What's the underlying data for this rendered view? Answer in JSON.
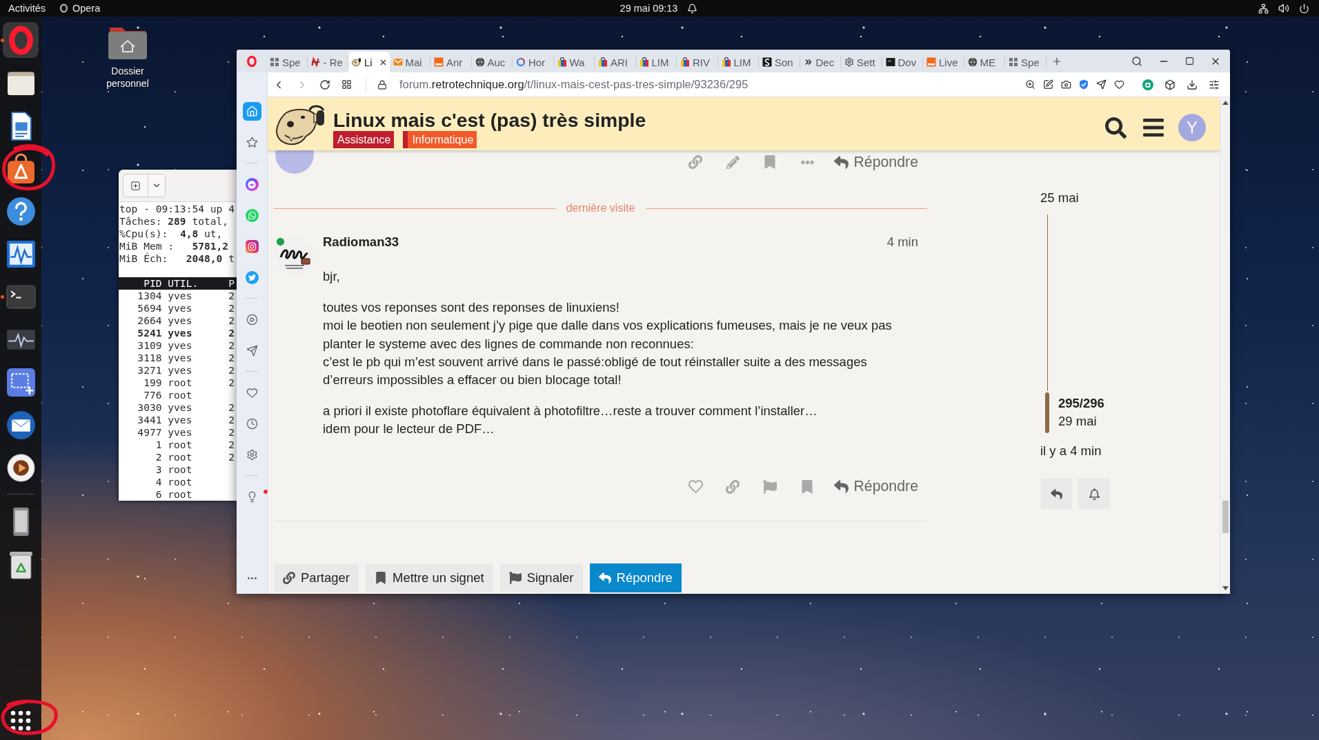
{
  "top_bar": {
    "activities": "Activités",
    "app_menu": "Opera",
    "date": "29 mai",
    "time": "09:13"
  },
  "dock": {
    "apps": [
      {
        "kind": "opera",
        "selected": true,
        "running": true,
        "circled": false
      },
      {
        "kind": "files",
        "selected": false,
        "running": false,
        "circled": false
      },
      {
        "kind": "writer",
        "selected": false,
        "running": false,
        "circled": false
      },
      {
        "kind": "software",
        "selected": false,
        "running": false,
        "circled": true
      },
      {
        "kind": "help",
        "selected": false,
        "running": false,
        "circled": false
      },
      {
        "kind": "monitor",
        "selected": false,
        "running": false,
        "circled": false
      },
      {
        "kind": "terminal",
        "selected": false,
        "running": true,
        "circled": false
      },
      {
        "kind": "activity",
        "selected": false,
        "running": false,
        "circled": false
      },
      {
        "kind": "screenshot",
        "selected": false,
        "running": false,
        "circled": false
      },
      {
        "kind": "mail",
        "selected": false,
        "running": false,
        "circled": false
      },
      {
        "kind": "music",
        "selected": false,
        "running": false,
        "circled": false
      },
      {
        "kind": "separator"
      },
      {
        "kind": "phone",
        "selected": false,
        "running": false,
        "circled": false
      },
      {
        "kind": "trash",
        "selected": false,
        "running": false,
        "circled": false
      }
    ],
    "app_grid": {
      "circled": true
    }
  },
  "desktop_icons": [
    {
      "label": "Dossier personnel"
    }
  ],
  "terminal": {
    "summary": [
      "top - 09:13:54 up 4",
      "Tâches: **289** total,",
      "%Cpu(s):  **4,8** ut,",
      "MiB Mem :   **5781,2**",
      "MiB Éch:   **2048,0** t"
    ],
    "columns": [
      "PID",
      "UTIL.",
      "P"
    ],
    "rows": [
      {
        "pid": "1304",
        "user": "yves",
        "column_3": "2",
        "highlighted": false
      },
      {
        "pid": "5694",
        "user": "yves",
        "column_3": "2",
        "highlighted": false
      },
      {
        "pid": "2664",
        "user": "yves",
        "column_3": "2",
        "highlighted": false
      },
      {
        "pid": "5241",
        "user": "yves",
        "column_3": "2",
        "highlighted": true
      },
      {
        "pid": "3109",
        "user": "yves",
        "column_3": "2",
        "highlighted": false
      },
      {
        "pid": "3118",
        "user": "yves",
        "column_3": "2",
        "highlighted": false
      },
      {
        "pid": "3271",
        "user": "yves",
        "column_3": "2",
        "highlighted": false
      },
      {
        "pid": "199",
        "user": "root",
        "column_3": "2",
        "highlighted": false
      },
      {
        "pid": "776",
        "user": "root",
        "highlighted": false
      },
      {
        "pid": "3030",
        "user": "yves",
        "column_3": "2",
        "highlighted": false
      },
      {
        "pid": "3441",
        "user": "yves",
        "column_3": "2",
        "highlighted": false
      },
      {
        "pid": "4977",
        "user": "yves",
        "column_3": "2",
        "highlighted": false
      },
      {
        "pid": "1",
        "user": "root",
        "column_3": "2",
        "highlighted": false
      },
      {
        "pid": "2",
        "user": "root",
        "column_3": "2",
        "highlighted": false
      },
      {
        "pid": "3",
        "user": "root",
        "highlighted": false
      },
      {
        "pid": "4",
        "user": "root",
        "highlighted": false
      },
      {
        "pid": "6",
        "user": "root",
        "highlighted": false
      }
    ]
  },
  "browser": {
    "tabs": [
      {
        "title": "Spe",
        "kind": "grid",
        "selected": false
      },
      {
        "title": "- Re",
        "kind": "news",
        "selected": false
      },
      {
        "title": "Li",
        "kind": "forum",
        "selected": true
      },
      {
        "title": "Mai",
        "kind": "mail",
        "selected": false
      },
      {
        "title": "Anr",
        "kind": "square",
        "selected": false
      },
      {
        "title": "Auc",
        "kind": "globe",
        "selected": false
      },
      {
        "title": "Hor",
        "kind": "ring",
        "selected": false
      },
      {
        "title": "Wa",
        "kind": "bag",
        "selected": false
      },
      {
        "title": "ARI",
        "kind": "bag",
        "selected": false
      },
      {
        "title": "LIM",
        "kind": "bag",
        "selected": false
      },
      {
        "title": "RIV",
        "kind": "bag",
        "selected": false
      },
      {
        "title": "LIM",
        "kind": "bag",
        "selected": false
      },
      {
        "title": "Son",
        "kind": "letter",
        "selected": false
      },
      {
        "title": "Dec",
        "kind": "chevrons",
        "selected": false
      },
      {
        "title": "Sett",
        "kind": "gear",
        "selected": false
      },
      {
        "title": "Dov",
        "kind": "screen",
        "selected": false
      },
      {
        "title": "Live",
        "kind": "square",
        "selected": false
      },
      {
        "title": "ME",
        "kind": "globe",
        "selected": false
      },
      {
        "title": "Spe",
        "kind": "grid",
        "selected": false
      }
    ],
    "url": {
      "subdomain": "forum.",
      "domain": "retrotechnique.org",
      "path": "/t/linux-mais-cest-pas-tres-simple/93236/295"
    },
    "sidebar": [
      {
        "kind": "home",
        "selected": true
      },
      {
        "kind": "star",
        "selected": false
      },
      {
        "kind": "divider"
      },
      {
        "kind": "messenger",
        "selected": false
      },
      {
        "kind": "whatsapp",
        "selected": false
      },
      {
        "kind": "instagram",
        "selected": false
      },
      {
        "kind": "twitter",
        "selected": false
      },
      {
        "kind": "divider"
      },
      {
        "kind": "player",
        "selected": false
      },
      {
        "kind": "flow",
        "selected": false
      },
      {
        "kind": "divider"
      },
      {
        "kind": "heart",
        "selected": false
      },
      {
        "kind": "history",
        "selected": false
      },
      {
        "kind": "settings",
        "selected": false
      },
      {
        "kind": "divider"
      },
      {
        "kind": "tips",
        "selected": false,
        "notification": true
      },
      {
        "kind": "more",
        "selected": false
      }
    ]
  },
  "page": {
    "title": "Linux mais c'est (pas) très simple",
    "tags": [
      {
        "label": "Assistance",
        "color": "#bf1e2e"
      },
      {
        "label": "Informatique",
        "color": "#f1592a",
        "parent": {
          "color": "#bf1e2e"
        }
      }
    ],
    "user_initial": "Y",
    "previous_post": {
      "actions": [
        {
          "kind": "link"
        },
        {
          "kind": "edit"
        },
        {
          "kind": "bookmark"
        },
        {
          "kind": "more"
        }
      ],
      "reply": "Répondre"
    },
    "last_visit": "dernière visite",
    "post": {
      "author": "Radioman33",
      "online": true,
      "age": "4 min",
      "paragraphs": [
        [
          "bjr,"
        ],
        [
          "toutes vos reponses sont des reponses de linuxiens!",
          "moi le beotien non seulement j’y pige que dalle dans vos explications fumeuses, mais je ne veux pas planter le systeme avec des lignes de commande non reconnues:",
          "c’est le pb qui m’est souvent arrivé dans le passé:obligé de tout réinstaller suite a des messages d’erreurs impossibles a effacer ou bien blocage total!"
        ],
        [
          "a priori il existe photoflare équivalent à photofiltre…reste a trouver comment l’installer…",
          "idem pour le lecteur de PDF…"
        ]
      ],
      "actions": [
        {
          "kind": "like"
        },
        {
          "kind": "link"
        },
        {
          "kind": "flag"
        },
        {
          "kind": "bookmark"
        }
      ],
      "reply": "Répondre"
    },
    "footer_buttons": [
      {
        "label": "Partager",
        "kind": "share",
        "primary": false
      },
      {
        "label": "Mettre un signet",
        "kind": "bookmark",
        "primary": false
      },
      {
        "label": "Signaler",
        "kind": "flag",
        "primary": false
      },
      {
        "label": "Répondre",
        "kind": "reply",
        "primary": true
      }
    ],
    "timeline": {
      "start": "25 mai",
      "position": "295/296",
      "date": "29 mai",
      "last_activity": "il y a 4 min",
      "buttons": [
        {
          "kind": "reply"
        },
        {
          "kind": "notifications"
        }
      ]
    }
  }
}
